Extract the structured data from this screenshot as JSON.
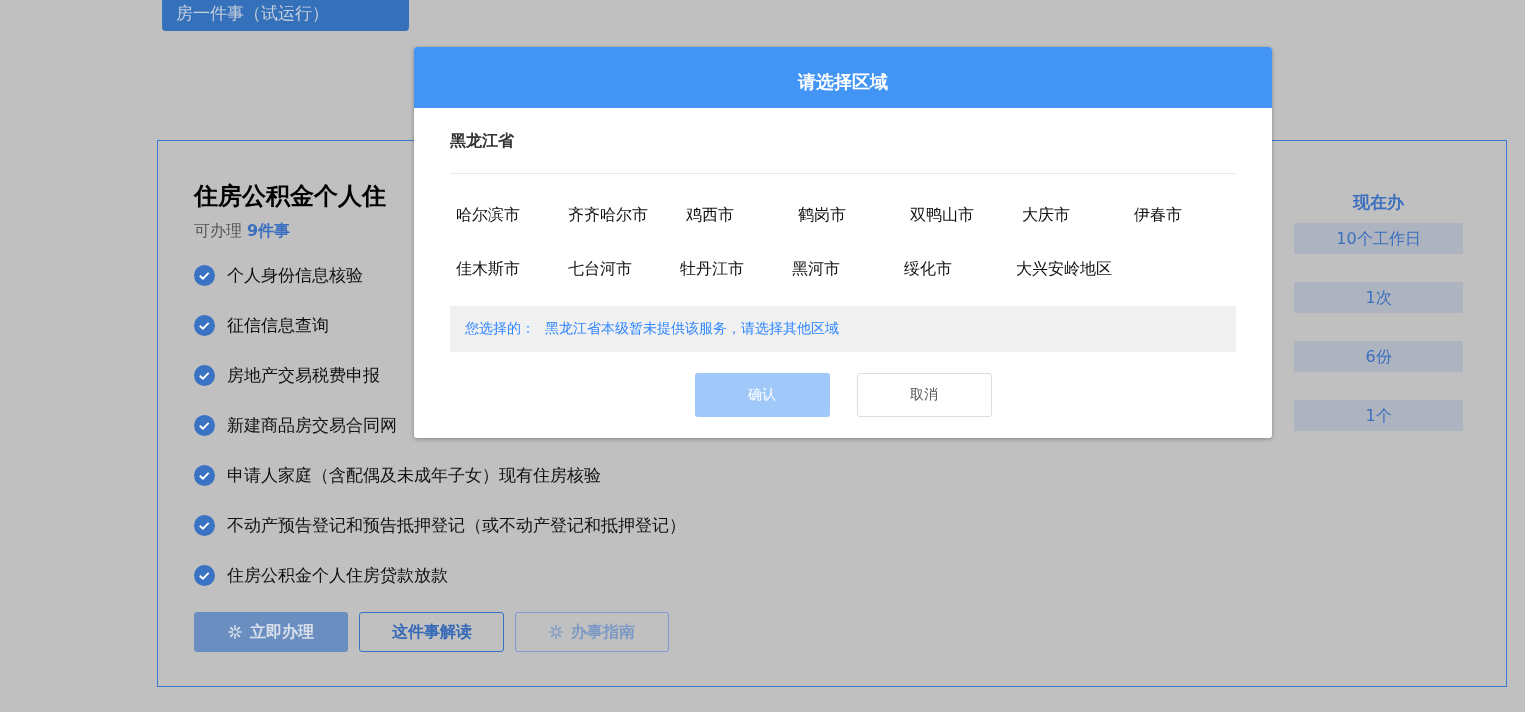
{
  "top_tab": {
    "label": "房一件事（试运行）"
  },
  "card": {
    "title": "住房公积金个人住",
    "subtitle": {
      "prefix": "可办理",
      "count": "9件事"
    },
    "items": [
      "个人身份信息核验",
      "征信信息查询",
      "房地产交易税费申报",
      "新建商品房交易合同网",
      "申请人家庭（含配偶及未成年子女）现有住房核验",
      "不动产预告登记和预告抵押登记（或不动产登记和抵押登记）",
      "住房公积金个人住房贷款放款"
    ],
    "buttons": [
      {
        "label": "立即办理",
        "kind": "primary",
        "loading": true
      },
      {
        "label": "这件事解读",
        "kind": "outline",
        "loading": false
      },
      {
        "label": "办事指南",
        "kind": "muted",
        "loading": true
      }
    ]
  },
  "side": {
    "heading": "现在办",
    "chips": [
      "10个工作日",
      "1次",
      "6份",
      "1个"
    ]
  },
  "dialog": {
    "title": "请选择区域",
    "province": "黑龙江省",
    "cities": [
      "哈尔滨市",
      "齐齐哈尔市",
      "鸡西市",
      "鹤岗市",
      "双鸭山市",
      "大庆市",
      "伊春市",
      "佳木斯市",
      "七台河市",
      "牡丹江市",
      "黑河市",
      "绥化市",
      "大兴安岭地区"
    ],
    "notice": {
      "label": "您选择的：",
      "message": "黑龙江省本级暂未提供该服务，请选择其他区域"
    },
    "buttons": [
      {
        "label": "确认",
        "kind": "primary",
        "disabled": true
      },
      {
        "label": "取消",
        "kind": "default",
        "disabled": false
      }
    ]
  }
}
